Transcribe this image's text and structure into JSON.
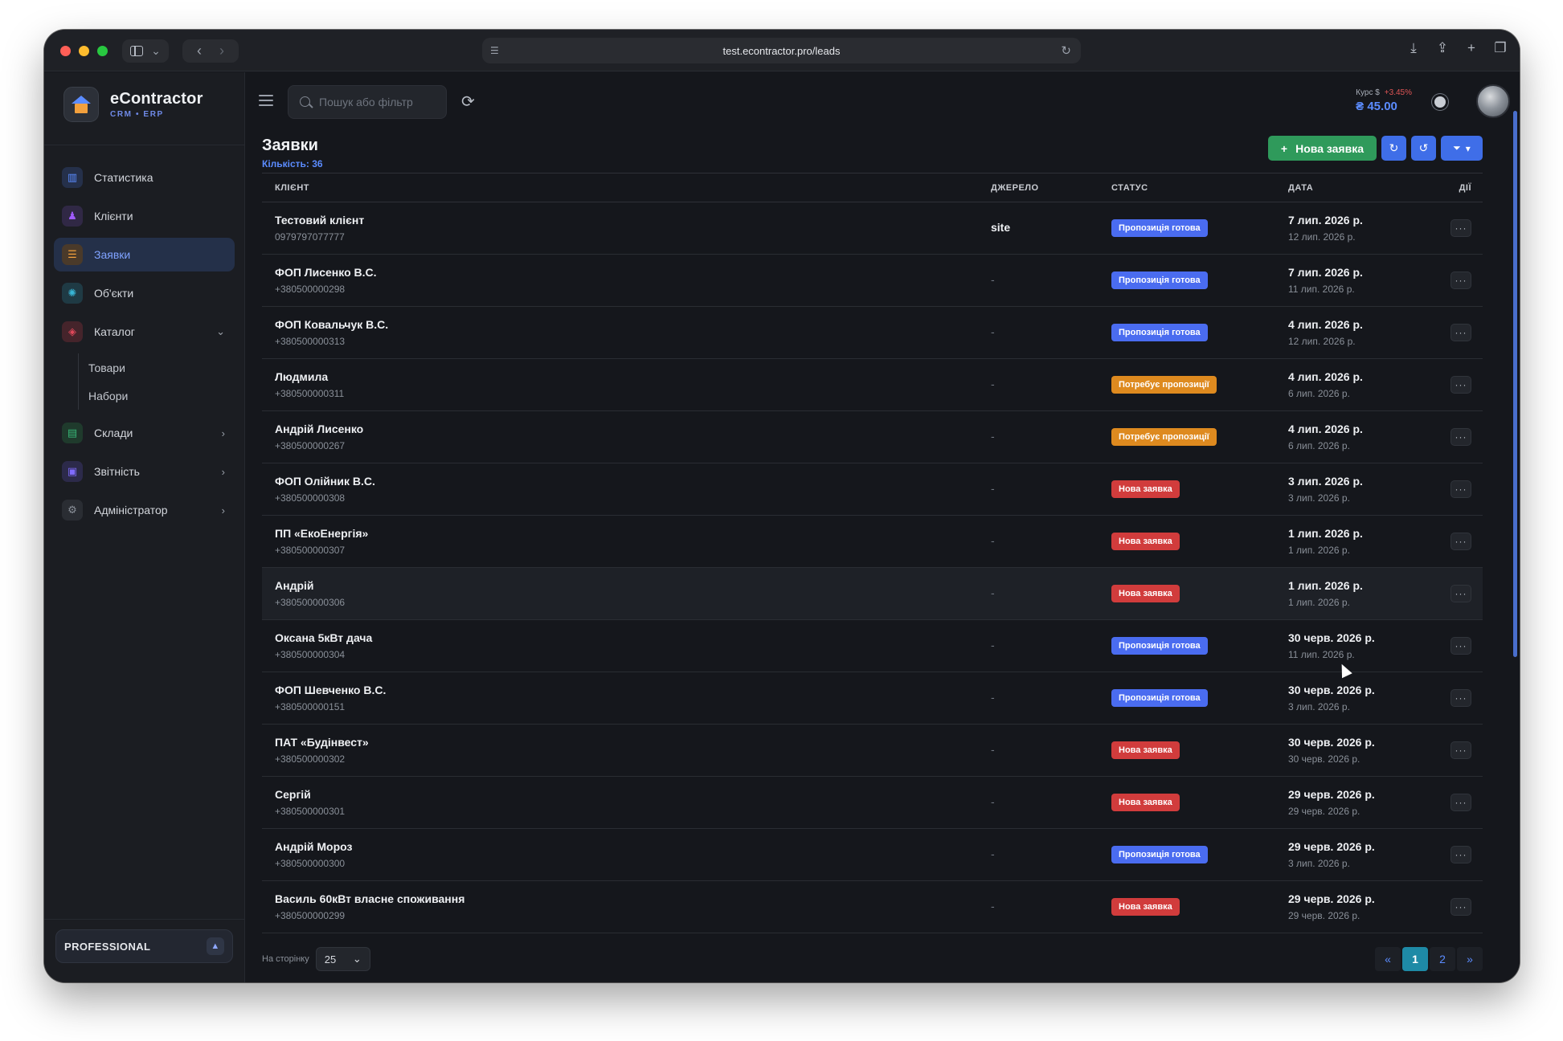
{
  "browser": {
    "url": "test.econtractor.pro/leads"
  },
  "brand": {
    "name": "eContractor",
    "subtitle": "CRM • ERP"
  },
  "sidebar": {
    "items": [
      {
        "label": "Статистика",
        "icon": "chart-icon",
        "color": "#5b8cff"
      },
      {
        "label": "Клієнти",
        "icon": "users-icon",
        "color": "#a05bff"
      },
      {
        "label": "Заявки",
        "icon": "leads-icon",
        "color": "#f2a03d",
        "active": true
      },
      {
        "label": "Об'єкти",
        "icon": "building-icon",
        "color": "#38b6d6"
      },
      {
        "label": "Каталог",
        "icon": "box-icon",
        "color": "#e0485a",
        "expanded": true,
        "children": [
          "Товари",
          "Набори"
        ]
      },
      {
        "label": "Склади",
        "icon": "warehouse-icon",
        "color": "#37b676"
      },
      {
        "label": "Звітність",
        "icon": "report-icon",
        "color": "#7f6bff"
      },
      {
        "label": "Адміністратор",
        "icon": "gear-icon",
        "color": "#8a9099"
      }
    ],
    "plan": "PROFESSIONAL"
  },
  "header": {
    "search_placeholder": "Пошук або фільтр",
    "rate_label": "Курс $",
    "rate_change": "+3.45%",
    "rate_value": "₴ 45.00"
  },
  "page": {
    "title": "Заявки",
    "count": "Кількість: 36",
    "new_button": "Нова заявка"
  },
  "table": {
    "columns": {
      "client": "КЛІЄНТ",
      "source": "ДЖЕРЕЛО",
      "status": "СТАТУС",
      "date": "ДАТА",
      "actions": "ДІЇ"
    },
    "status_colors": {
      "Пропозиція готова": "#4a6cf0",
      "Потребує пропозиції": "#de8a1f",
      "Нова заявка": "#d13c3c"
    },
    "rows": [
      {
        "name": "Тестовий клієнт",
        "phone": "0979797077777",
        "source": "site",
        "status": "Пропозиція готова",
        "date": "7 лип. 2026 р.",
        "date2": "12 лип. 2026 р."
      },
      {
        "name": "ФОП Лисенко В.С.",
        "phone": "+380500000298",
        "source": "-",
        "status": "Пропозиція готова",
        "date": "7 лип. 2026 р.",
        "date2": "11 лип. 2026 р."
      },
      {
        "name": "ФОП Ковальчук В.С.",
        "phone": "+380500000313",
        "source": "-",
        "status": "Пропозиція готова",
        "date": "4 лип. 2026 р.",
        "date2": "12 лип. 2026 р."
      },
      {
        "name": "Людмила",
        "phone": "+380500000311",
        "source": "-",
        "status": "Потребує пропозиції",
        "date": "4 лип. 2026 р.",
        "date2": "6 лип. 2026 р."
      },
      {
        "name": "Андрій Лисенко",
        "phone": "+380500000267",
        "source": "-",
        "status": "Потребує пропозиції",
        "date": "4 лип. 2026 р.",
        "date2": "6 лип. 2026 р."
      },
      {
        "name": "ФОП Олійник В.С.",
        "phone": "+380500000308",
        "source": "-",
        "status": "Нова заявка",
        "date": "3 лип. 2026 р.",
        "date2": "3 лип. 2026 р."
      },
      {
        "name": "ПП «ЕкоЕнергія»",
        "phone": "+380500000307",
        "source": "-",
        "status": "Нова заявка",
        "date": "1 лип. 2026 р.",
        "date2": "1 лип. 2026 р."
      },
      {
        "name": "Андрій",
        "phone": "+380500000306",
        "source": "-",
        "status": "Нова заявка",
        "date": "1 лип. 2026 р.",
        "date2": "1 лип. 2026 р.",
        "hover": true
      },
      {
        "name": "Оксана 5кВт дача",
        "phone": "+380500000304",
        "source": "-",
        "status": "Пропозиція готова",
        "date": "30 черв. 2026 р.",
        "date2": "11 лип. 2026 р."
      },
      {
        "name": "ФОП Шевченко В.С.",
        "phone": "+380500000151",
        "source": "-",
        "status": "Пропозиція готова",
        "date": "30 черв. 2026 р.",
        "date2": "3 лип. 2026 р."
      },
      {
        "name": "ПАТ «Будінвест»",
        "phone": "+380500000302",
        "source": "-",
        "status": "Нова заявка",
        "date": "30 черв. 2026 р.",
        "date2": "30 черв. 2026 р."
      },
      {
        "name": "Сергій",
        "phone": "+380500000301",
        "source": "-",
        "status": "Нова заявка",
        "date": "29 черв. 2026 р.",
        "date2": "29 черв. 2026 р."
      },
      {
        "name": "Андрій Мороз",
        "phone": "+380500000300",
        "source": "-",
        "status": "Пропозиція готова",
        "date": "29 черв. 2026 р.",
        "date2": "3 лип. 2026 р."
      },
      {
        "name": "Василь 60кВт власне споживання",
        "phone": "+380500000299",
        "source": "-",
        "status": "Нова заявка",
        "date": "29 черв. 2026 р.",
        "date2": "29 черв. 2026 р."
      }
    ]
  },
  "pagination": {
    "per_page_label": "На сторінку",
    "per_page": "25",
    "prev": "«",
    "pages": [
      "1",
      "2"
    ],
    "next": "»"
  }
}
